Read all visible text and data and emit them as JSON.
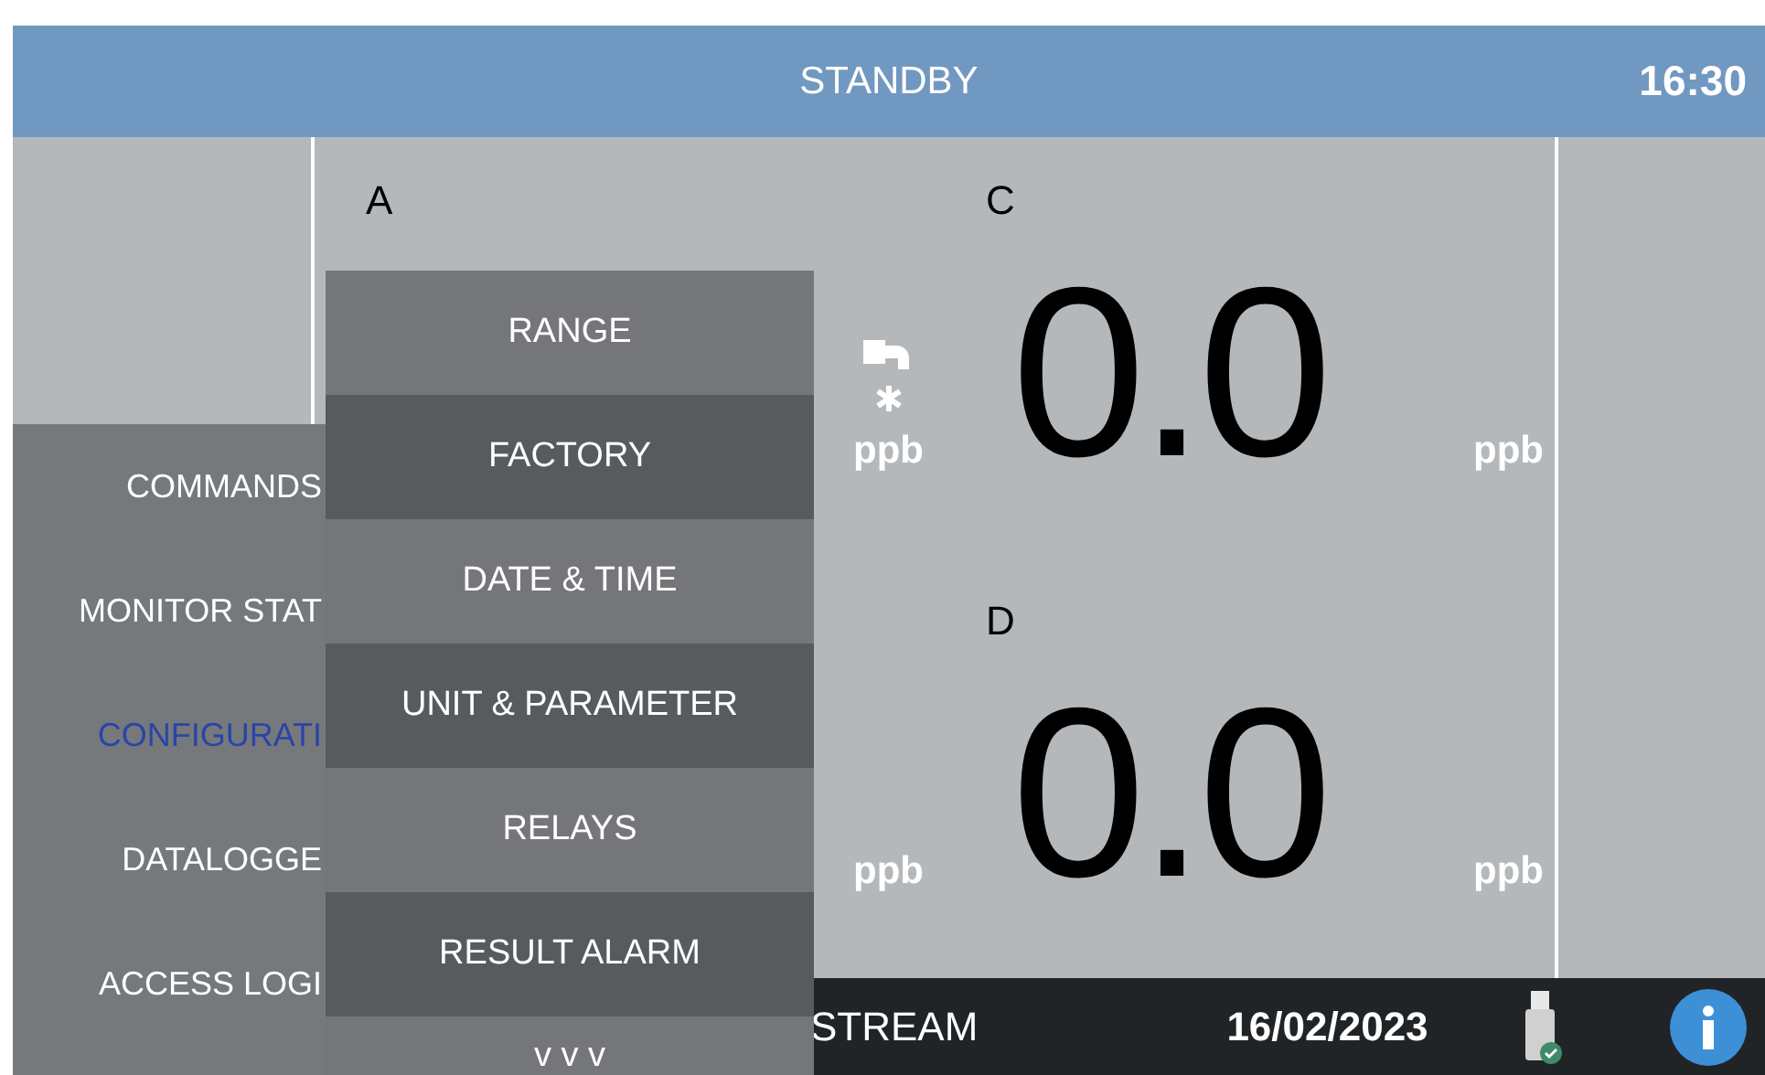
{
  "status_bar": {
    "title": "STANDBY",
    "time": "16:30"
  },
  "channels": [
    {
      "label": "A",
      "unit": "ppb",
      "alarm_icon": true
    },
    {
      "unit": "ppb"
    },
    {
      "label": "C",
      "value": "0.0",
      "unit": "ppb"
    },
    {
      "label": "D",
      "value": "0.0",
      "unit": "ppb"
    }
  ],
  "main_menu": [
    {
      "label": "COMMANDS",
      "selected": false
    },
    {
      "label": "MONITOR STAT",
      "selected": false
    },
    {
      "label": "CONFIGURATI",
      "selected": true
    },
    {
      "label": "DATALOGGE",
      "selected": false
    },
    {
      "label": "ACCESS LOGI",
      "selected": false
    }
  ],
  "submenu": [
    {
      "label": "RANGE"
    },
    {
      "label": "FACTORY"
    },
    {
      "label": "DATE & TIME"
    },
    {
      "label": "UNIT & PARAMETER"
    },
    {
      "label": "RELAYS"
    },
    {
      "label": "RESULT ALARM"
    },
    {
      "label": "v v v"
    }
  ],
  "footer": {
    "stream": "STREAM",
    "date": "16/02/2023",
    "usb_connected": true
  }
}
